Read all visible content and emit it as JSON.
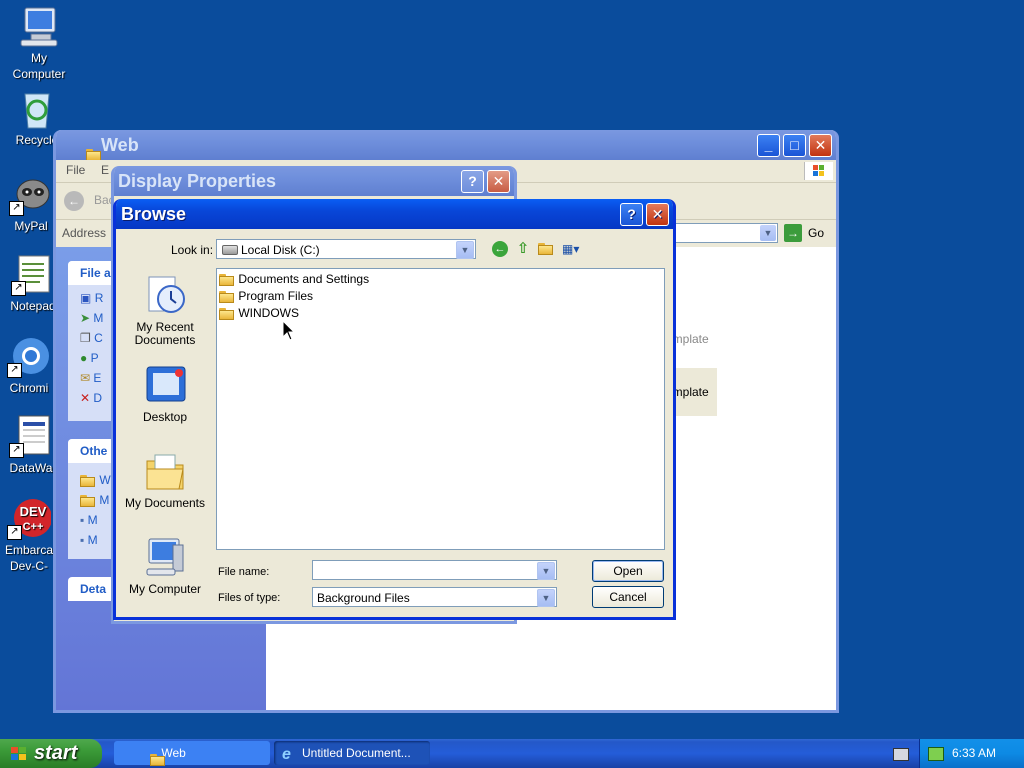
{
  "desktop": {
    "icons": [
      {
        "label_line1": "My",
        "label_line2": "Computer"
      },
      {
        "label_line1": "Recycle",
        "label_line2": ""
      },
      {
        "label_line1": "MyPal",
        "label_line2": ""
      },
      {
        "label_line1": "Notepad",
        "label_line2": ""
      },
      {
        "label_line1": "Chromi",
        "label_line2": ""
      },
      {
        "label_line1": "DataWa",
        "label_line2": ""
      },
      {
        "label_line1": "Embarca",
        "label_line2": "Dev-C-"
      }
    ]
  },
  "explorer": {
    "title": "Web",
    "menu": {
      "file": "File",
      "edit": "E"
    },
    "back_label": "Bac",
    "address_label": "Address",
    "go_label": "Go",
    "tasks_header": "File a",
    "tasks_items": [
      "R",
      "M",
      "C",
      "P",
      "E",
      "D"
    ],
    "other_header": "Othe",
    "other_items": [
      "W",
      "M",
      "M",
      "M"
    ],
    "details_header": "Deta",
    "content_item1": "emplate",
    "content_item2": "emplate"
  },
  "display_properties": {
    "title": "Display Properties"
  },
  "browse": {
    "title": "Browse",
    "look_in_label": "Look in:",
    "look_in_value": "Local Disk (C:)",
    "places": [
      {
        "label_line1": "My Recent",
        "label_line2": "Documents"
      },
      {
        "label_line1": "Desktop",
        "label_line2": ""
      },
      {
        "label_line1": "My Documents",
        "label_line2": ""
      },
      {
        "label_line1": "My Computer",
        "label_line2": ""
      }
    ],
    "files": [
      "Documents and Settings",
      "Program Files",
      "WINDOWS"
    ],
    "file_name_label": "File name:",
    "file_name_value": "",
    "files_of_type_label": "Files of type:",
    "files_of_type_value": "Background Files",
    "open_label": "Open",
    "cancel_label": "Cancel"
  },
  "taskbar": {
    "start_label": "start",
    "tasks": [
      "Web",
      "Untitled Document..."
    ],
    "clock": "6:33 AM"
  }
}
